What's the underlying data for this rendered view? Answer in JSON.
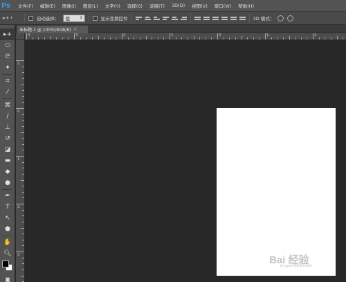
{
  "app": {
    "logo": "Ps"
  },
  "menu": [
    "文件(F)",
    "编辑(E)",
    "图像(I)",
    "图层(L)",
    "文字(Y)",
    "选择(S)",
    "滤镜(T)",
    "3D(D)",
    "视图(V)",
    "窗口(W)",
    "帮助(H)"
  ],
  "options": {
    "auto_select_label": "自动选择：",
    "auto_select_value": "组",
    "show_transform_label": "显示变换控件",
    "mode3d_label": "3D 模式："
  },
  "document": {
    "tab_title": "未标题-1 @ 100%(RGB/8)",
    "close": "×"
  },
  "rulers": {
    "h_labels": [
      "4",
      "3",
      "2",
      "1",
      "0",
      "1",
      "2"
    ],
    "v_labels": [
      "1",
      "0",
      "1",
      "2",
      "3"
    ]
  },
  "colors": {
    "foreground": "#000000",
    "background": "#ffffff",
    "canvas": "#ffffff",
    "workspace": "#282828"
  },
  "tools": [
    "move-icon",
    "marquee-icon",
    "lasso-icon",
    "magic-wand-icon",
    "crop-icon",
    "eyedropper-icon",
    "healing-brush-icon",
    "brush-icon",
    "clone-stamp-icon",
    "history-brush-icon",
    "eraser-icon",
    "gradient-icon",
    "blur-icon",
    "dodge-icon",
    "pen-icon",
    "type-icon",
    "path-selection-icon",
    "shape-icon",
    "hand-icon",
    "zoom-icon"
  ],
  "watermark": {
    "text": "Bai 经验",
    "sub": "jingyan.baidu.com"
  }
}
